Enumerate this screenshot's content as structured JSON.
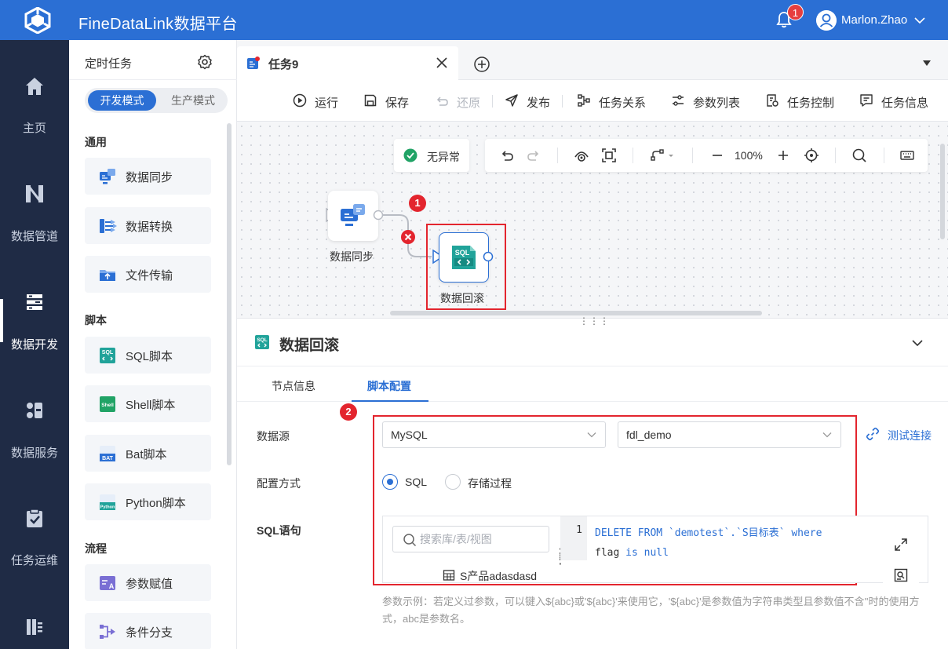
{
  "app": {
    "brand": "FineDataLink数据平台",
    "notifications_count": "1",
    "user_name": "Marlon.Zhao"
  },
  "leftnav": {
    "items": [
      {
        "label": "主页",
        "icon": "home-icon"
      },
      {
        "label": "数据管道",
        "icon": "pipeline-icon"
      },
      {
        "label": "数据开发",
        "icon": "data-dev-icon"
      },
      {
        "label": "数据服务",
        "icon": "data-service-icon"
      },
      {
        "label": "任务运维",
        "icon": "task-ops-icon"
      },
      {
        "label": "",
        "icon": "more-icon"
      }
    ],
    "active": "数据开发"
  },
  "panel": {
    "title": "定时任务",
    "mode_dev": "开发模式",
    "mode_prod": "生产模式",
    "categories": {
      "general": "通用",
      "script": "脚本",
      "flow": "流程"
    },
    "tools": {
      "data_sync": "数据同步",
      "data_transform": "数据转换",
      "file_transfer": "文件传输",
      "sql_script": "SQL脚本",
      "shell_script": "Shell脚本",
      "bat_script": "Bat脚本",
      "python_script": "Python脚本",
      "param_assign": "参数赋值",
      "condition_branch": "条件分支"
    }
  },
  "tabs": {
    "active_label": "任务9"
  },
  "toolbar": {
    "run": "运行",
    "save": "保存",
    "restore": "还原",
    "publish": "发布",
    "task_relation": "任务关系",
    "param_list": "参数列表",
    "task_control": "任务控制",
    "task_info": "任务信息"
  },
  "canvas": {
    "status": "无异常",
    "zoom": "100%",
    "nodes": {
      "sync": "数据同步",
      "rollback": "数据回滚"
    },
    "badges": {
      "one": "1",
      "two": "2"
    }
  },
  "detail": {
    "title": "数据回滚",
    "tab_node_info": "节点信息",
    "tab_script_config": "脚本配置",
    "label_datasource": "数据源",
    "datasource_type": "MySQL",
    "datasource_db": "fdl_demo",
    "test_connection": "测试连接",
    "label_config_mode": "配置方式",
    "mode_sql": "SQL",
    "mode_proc": "存储过程",
    "label_sql": "SQL语句",
    "search_placeholder": "搜索库/表/视图",
    "table_item": "S产品adasdasd",
    "line_number": "1",
    "code_part1": "DELETE FROM `demotest`.`S目标表`",
    "code_where": "where",
    "code_flag": "flag",
    "code_is": "is",
    "code_null": "null",
    "hint": "参数示例：若定义过参数，可以键入${abc}或'${abc}'来使用它，'${abc}'是参数值为字符串类型且参数值不含''时的使用方式，abc是参数名。"
  },
  "colors": {
    "primary": "#2b6fd4",
    "nav_bg": "#1f2b45",
    "danger": "#e3252e",
    "success": "#21a366"
  }
}
